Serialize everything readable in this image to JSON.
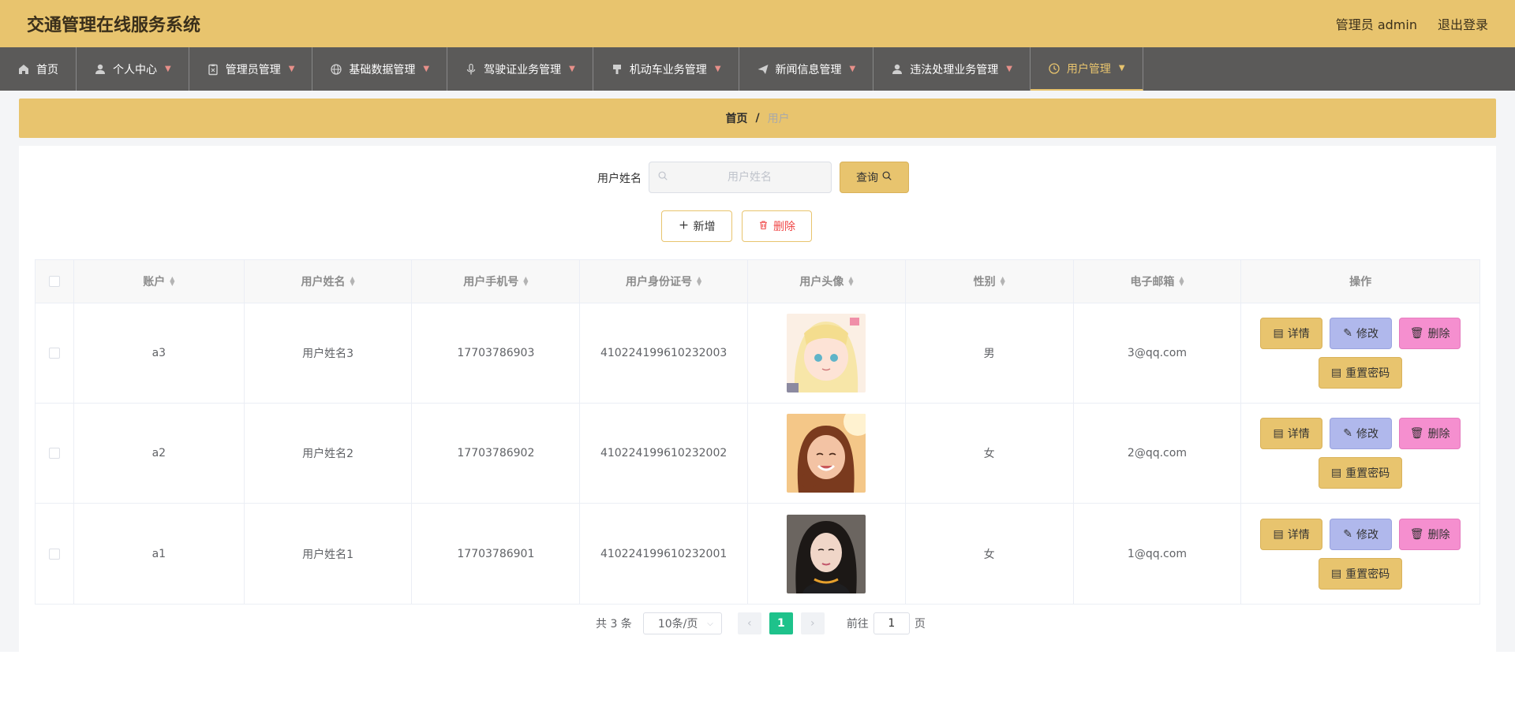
{
  "header": {
    "title": "交通管理在线服务系统",
    "user_label": "管理员 admin",
    "logout_label": "退出登录"
  },
  "nav": {
    "items": [
      {
        "label": "首页",
        "icon": "home-icon"
      },
      {
        "label": "个人中心",
        "icon": "user-icon"
      },
      {
        "label": "管理员管理",
        "icon": "clipboard-icon"
      },
      {
        "label": "基础数据管理",
        "icon": "globe-icon"
      },
      {
        "label": "驾驶证业务管理",
        "icon": "microphone-icon"
      },
      {
        "label": "机动车业务管理",
        "icon": "stamp-icon"
      },
      {
        "label": "新闻信息管理",
        "icon": "send-icon"
      },
      {
        "label": "违法处理业务管理",
        "icon": "user-icon"
      },
      {
        "label": "用户管理",
        "icon": "clock-icon"
      }
    ],
    "active_index": 8
  },
  "breadcrumb": {
    "home": "首页",
    "separator": "/",
    "current": "用户"
  },
  "search": {
    "label": "用户姓名",
    "placeholder": "用户姓名",
    "value": "",
    "button_label": "查询"
  },
  "actions": {
    "add_label": "新增",
    "delete_label": "删除"
  },
  "table": {
    "columns": [
      "账户",
      "用户姓名",
      "用户手机号",
      "用户身份证号",
      "用户头像",
      "性别",
      "电子邮箱",
      "操作"
    ],
    "rows": [
      {
        "account": "a3",
        "name": "用户姓名3",
        "phone": "17703786903",
        "id_card": "410224199610232003",
        "gender": "男",
        "email": "3@qq.com"
      },
      {
        "account": "a2",
        "name": "用户姓名2",
        "phone": "17703786902",
        "id_card": "410224199610232002",
        "gender": "女",
        "email": "2@qq.com"
      },
      {
        "account": "a1",
        "name": "用户姓名1",
        "phone": "17703786901",
        "id_card": "410224199610232001",
        "gender": "女",
        "email": "1@qq.com"
      }
    ],
    "ops": {
      "detail": "详情",
      "edit": "修改",
      "delete": "删除",
      "reset": "重置密码"
    }
  },
  "pagination": {
    "total_text": "共 3 条",
    "page_size": "10条/页",
    "current_page": "1",
    "goto_prefix": "前往",
    "goto_value": "1",
    "goto_suffix": "页"
  },
  "colors": {
    "accent": "#e8c46e",
    "nav_bg": "#5b5a59",
    "page_active": "#1ec28b",
    "edit": "#b0b8ec",
    "danger": "#f58fcf"
  }
}
